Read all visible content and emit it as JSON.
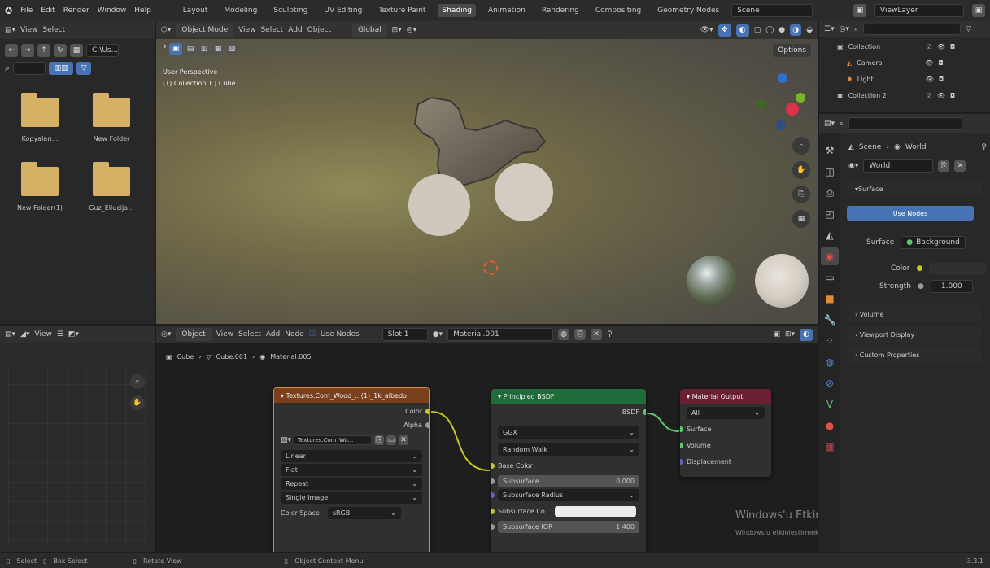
{
  "menu": [
    "File",
    "Edit",
    "Render",
    "Window",
    "Help"
  ],
  "workspaces": [
    "Layout",
    "Modeling",
    "Sculpting",
    "UV Editing",
    "Texture Paint",
    "Shading",
    "Animation",
    "Rendering",
    "Compositing",
    "Geometry Nodes"
  ],
  "scene_field": "Scene",
  "viewlayer_field": "ViewLayer",
  "filebrowser": {
    "view": "View",
    "select": "Select",
    "path_field": "C:\\Us...",
    "folders": [
      "Kopyaları...",
      "New Folder",
      "New Folder(1)",
      "Guz_Ellucija..."
    ]
  },
  "viewport": {
    "mode": "Object Mode",
    "menus": [
      "View",
      "Select",
      "Add",
      "Object"
    ],
    "orientation": "Global",
    "options": "Options",
    "info_line1": "User Perspective",
    "info_line2": "(1) Collection 1 | Cube"
  },
  "outliner": {
    "items": [
      "Collection",
      "Camera",
      "Light",
      "Collection 2"
    ]
  },
  "properties": {
    "breadcrumb_scene": "Scene",
    "breadcrumb_world": "World",
    "world_name": "World",
    "surface_section": "Surface",
    "use_nodes": "Use Nodes",
    "surface_label": "Surface",
    "surface_value": "Background",
    "color_label": "Color",
    "strength_label": "Strength",
    "strength_value": "1.000",
    "collapsed_sections": [
      "Volume",
      "Viewport Display",
      "Custom Properties"
    ]
  },
  "filebrowser_lower": {
    "view": "View"
  },
  "node_editor": {
    "editor": "Object",
    "menus": [
      "View",
      "Select",
      "Add",
      "Node"
    ],
    "use_nodes": "Use Nodes",
    "slot": "Slot 1",
    "material": "Material.001",
    "breadcrumb": [
      "Cube",
      "Cube.001",
      "Material.005"
    ]
  },
  "nodes": {
    "image": {
      "title": "Textures.Com_Wood_...(1)_1k_albedo",
      "out_color": "Color",
      "out_alpha": "Alpha",
      "image_name": "Textures.Com_Wo...",
      "interp": "Linear",
      "proj": "Flat",
      "ext": "Repeat",
      "source": "Single Image",
      "cs_label": "Color Space",
      "cs_value": "sRGB"
    },
    "bsdf": {
      "title": "Principled BSDF",
      "out_bsdf": "BSDF",
      "dist": "GGX",
      "sss_method": "Random Walk",
      "base_color": "Base Color",
      "subsurface": "Subsurface",
      "subsurface_value": "0.000",
      "sss_radius": "Subsurface Radius",
      "sss_color": "Subsurface Co...",
      "sss_ior": "Subsurface IOR",
      "sss_ior_value": "1.400"
    },
    "output": {
      "title": "Material Output",
      "target": "All",
      "surface": "Surface",
      "volume": "Volume",
      "displacement": "Displacement"
    }
  },
  "watermark": {
    "line1": "Windows'u Etkinleştir",
    "line2": "Windows'u etkinleştirmek için Ayarlar'a gidin."
  },
  "status": {
    "select": "Select",
    "box_select": "Box Select",
    "rotate": "Rotate View",
    "context": "Object Context Menu",
    "version": "3.3.1"
  }
}
